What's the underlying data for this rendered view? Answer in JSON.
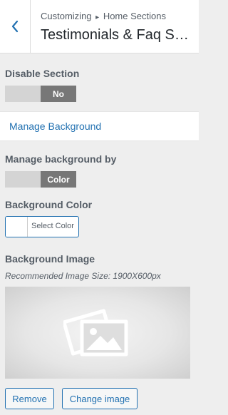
{
  "header": {
    "back_icon": "chevron-left-icon",
    "breadcrumb_root": "Customizing",
    "breadcrumb_separator": "▸",
    "breadcrumb_parent": "Home Sections",
    "title": "Testimonials & Faq Section"
  },
  "controls": {
    "disable_section": {
      "label": "Disable Section",
      "toggle_value": "No"
    },
    "manage_background": {
      "label": "Manage Background"
    },
    "manage_background_by": {
      "label": "Manage background by",
      "toggle_value": "Color"
    },
    "background_color": {
      "label": "Background Color",
      "button_label": "Select Color",
      "swatch_color": "#ffffff"
    },
    "background_image": {
      "label": "Background Image",
      "hint": "Recommended Image Size: 1900X600px",
      "placeholder_icon": "image-placeholder-icon",
      "remove_label": "Remove",
      "change_label": "Change image"
    }
  },
  "colors": {
    "accent": "#2271b1",
    "panel_bg": "#eeeeee",
    "toggle_active": "#777777",
    "toggle_track": "#d4d4d4"
  }
}
